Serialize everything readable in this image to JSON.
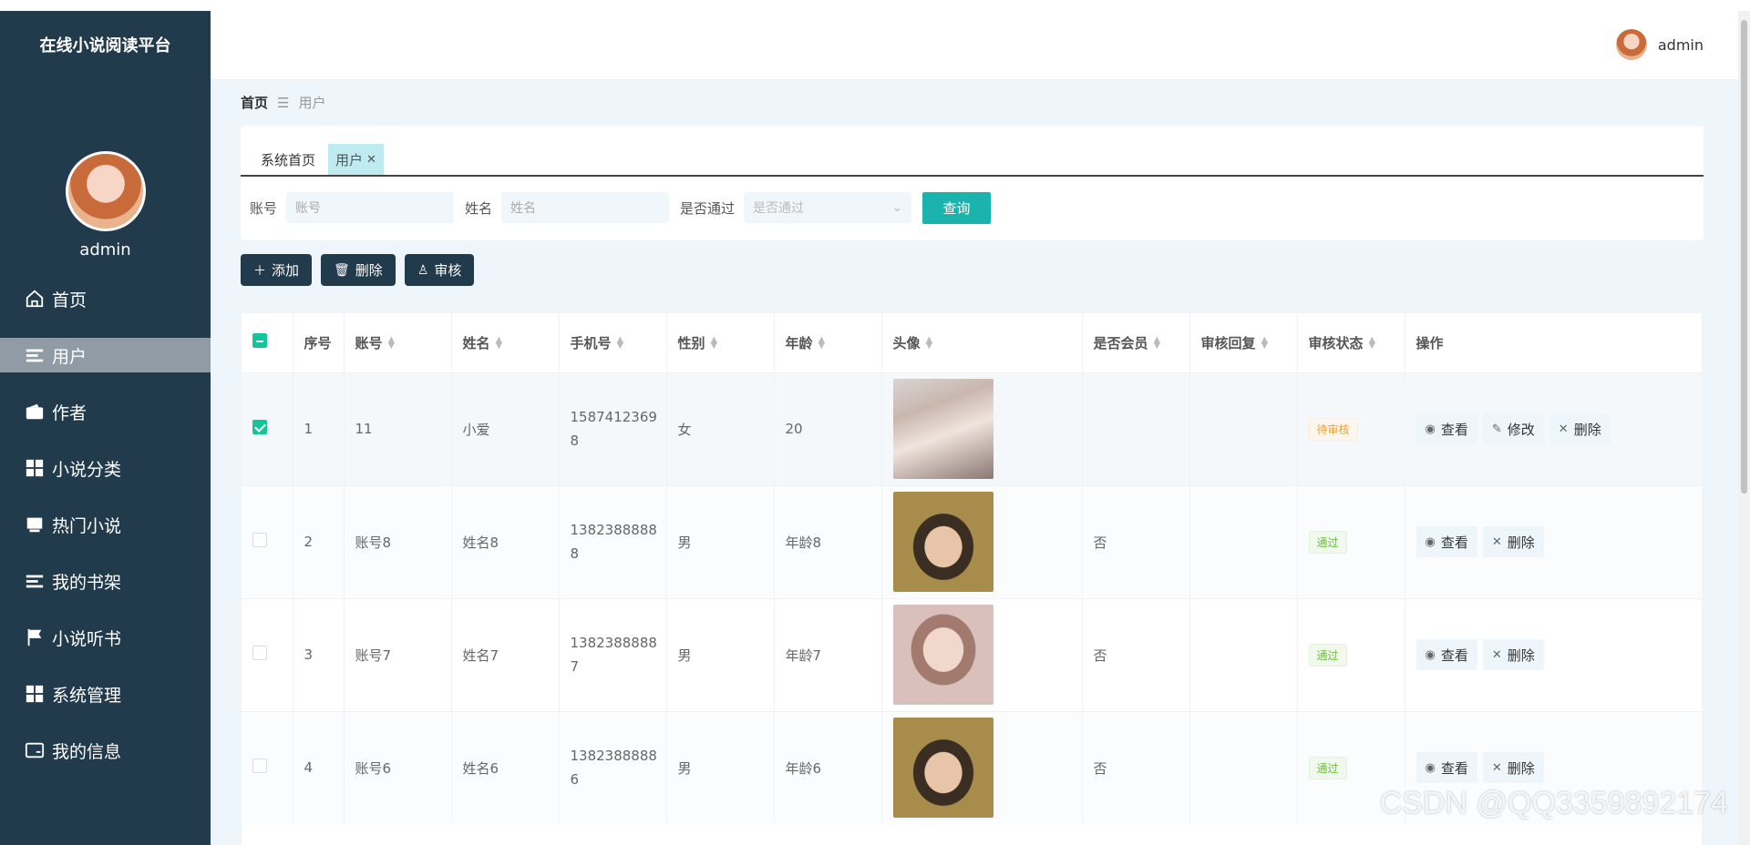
{
  "brand": "在线小说阅读平台",
  "sidebar": {
    "username": "admin",
    "items": [
      {
        "label": "首页",
        "icon": "home-icon"
      },
      {
        "label": "用户",
        "icon": "list-icon"
      },
      {
        "label": "作者",
        "icon": "wallet-icon"
      },
      {
        "label": "小说分类",
        "icon": "grid-icon"
      },
      {
        "label": "热门小说",
        "icon": "book-icon"
      },
      {
        "label": "我的书架",
        "icon": "list-icon"
      },
      {
        "label": "小说听书",
        "icon": "flag-icon"
      },
      {
        "label": "系统管理",
        "icon": "grid-icon"
      },
      {
        "label": "我的信息",
        "icon": "card-icon"
      }
    ],
    "active_index": 1
  },
  "topbar": {
    "username": "admin"
  },
  "breadcrumb": {
    "home": "首页",
    "sep": "☰",
    "current": "用户"
  },
  "tabs": [
    {
      "label": "系统首页"
    },
    {
      "label": "用户",
      "close": "✕"
    }
  ],
  "search": {
    "account_label": "账号",
    "account_placeholder": "账号",
    "name_label": "姓名",
    "name_placeholder": "姓名",
    "pass_label": "是否通过",
    "pass_placeholder": "是否通过",
    "query": "查询"
  },
  "toolbar": {
    "add": "添加",
    "delete": "删除",
    "audit": "审核"
  },
  "table": {
    "headers": [
      "序号",
      "账号",
      "姓名",
      "手机号",
      "性别",
      "年龄",
      "头像",
      "是否会员",
      "审核回复",
      "审核状态",
      "操作"
    ],
    "rows": [
      {
        "no": "1",
        "account": "11",
        "name": "小爱",
        "phone1": "1587412369",
        "phone2": "8",
        "gender": "女",
        "age": "20",
        "photo": "f",
        "vip": "",
        "reply": "",
        "status": "待审核",
        "status_type": "wait",
        "checked": true,
        "actions": [
          "查看",
          "修改",
          "删除"
        ]
      },
      {
        "no": "2",
        "account": "账号8",
        "name": "姓名8",
        "phone1": "1382388888",
        "phone2": "8",
        "gender": "男",
        "age": "年龄8",
        "photo": "m",
        "vip": "否",
        "reply": "",
        "status": "通过",
        "status_type": "pass",
        "checked": false,
        "actions": [
          "查看",
          "删除"
        ]
      },
      {
        "no": "3",
        "account": "账号7",
        "name": "姓名7",
        "phone1": "1382388888",
        "phone2": "7",
        "gender": "男",
        "age": "年龄7",
        "photo": "g",
        "vip": "否",
        "reply": "",
        "status": "通过",
        "status_type": "pass",
        "checked": false,
        "actions": [
          "查看",
          "删除"
        ]
      },
      {
        "no": "4",
        "account": "账号6",
        "name": "姓名6",
        "phone1": "1382388888",
        "phone2": "6",
        "gender": "男",
        "age": "年龄6",
        "photo": "m",
        "vip": "否",
        "reply": "",
        "status": "通过",
        "status_type": "pass",
        "checked": false,
        "actions": [
          "查看",
          "删除"
        ]
      }
    ]
  },
  "watermark": "CSDN @QQ3359892174"
}
